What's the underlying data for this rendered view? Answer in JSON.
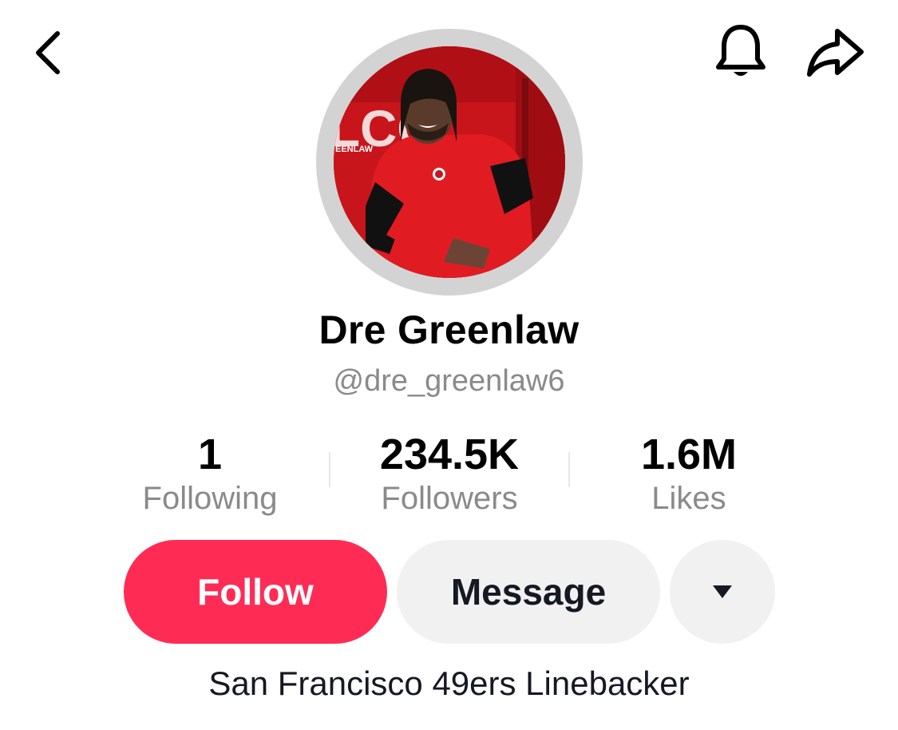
{
  "header": {
    "back_icon": "chevron-left-icon",
    "bell_icon": "bell-icon",
    "share_icon": "share-arrow-icon"
  },
  "profile": {
    "display_name": "Dre Greenlaw",
    "username": "@dre_greenlaw6",
    "bio": "San Francisco 49ers Linebacker",
    "avatar_backdrop_text_large": "LCO",
    "avatar_backdrop_text_small": "EENLAW"
  },
  "stats": [
    {
      "value": "1",
      "label": "Following"
    },
    {
      "value": "234.5K",
      "label": "Followers"
    },
    {
      "value": "1.6M",
      "label": "Likes"
    }
  ],
  "actions": {
    "follow_label": "Follow",
    "message_label": "Message",
    "more_icon": "caret-down-icon"
  },
  "colors": {
    "follow": "#fe2c55",
    "secondary_button": "#f1f1f2",
    "muted_text": "#8a8a8a",
    "avatar_ring": "#d3d3d3"
  }
}
